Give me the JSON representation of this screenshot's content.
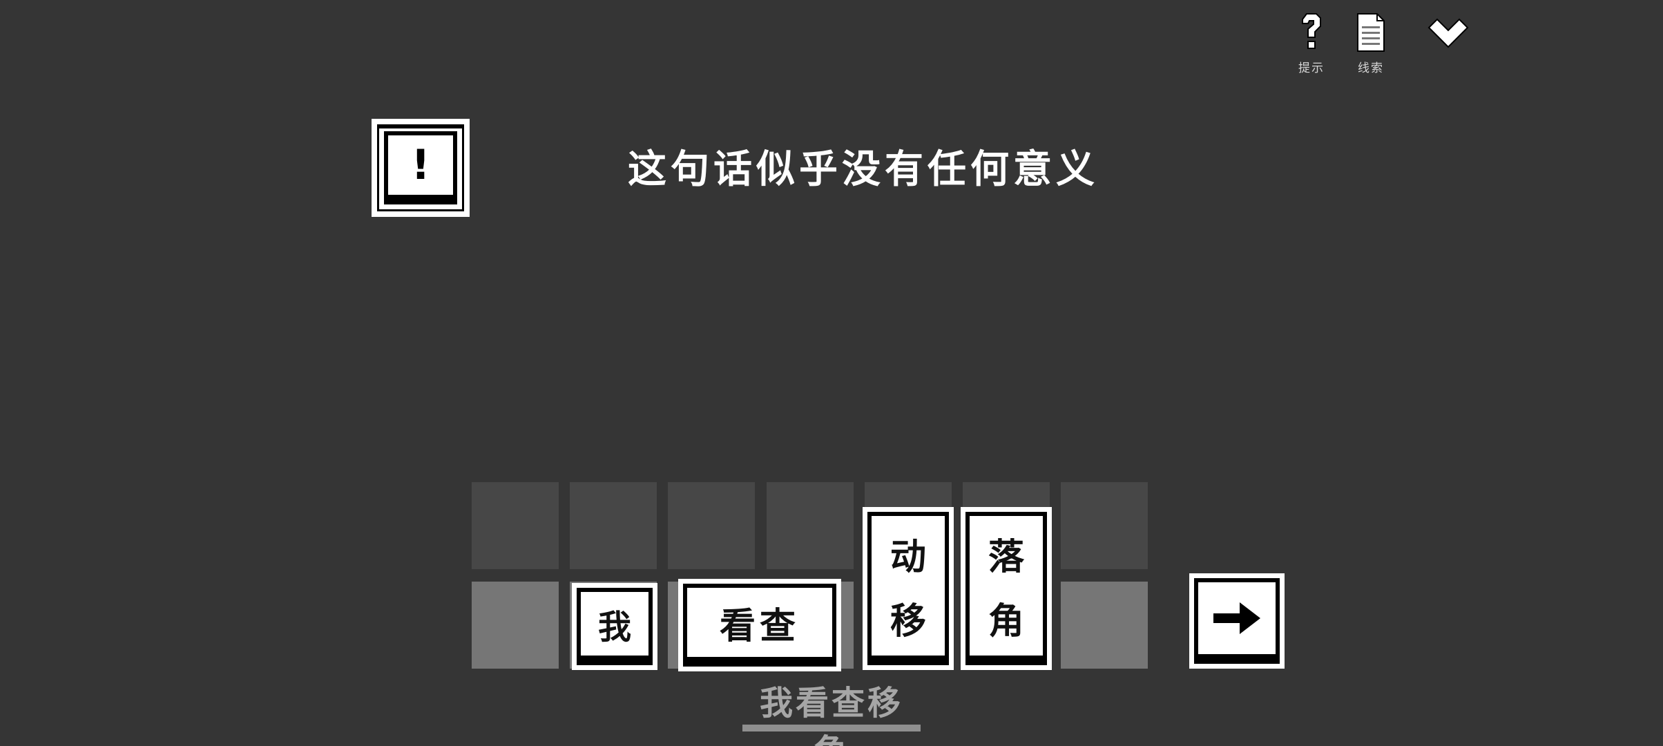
{
  "toolbar": {
    "hint_label": "提示",
    "clues_label": "线索"
  },
  "message": "这句话似乎没有任何意义",
  "alert_symbol": "!",
  "tiles": {
    "wo": "我",
    "kancha": "看查",
    "dong": "动",
    "yi": "移",
    "luo": "落",
    "jiao": "角"
  },
  "submit_icon": "arrow-right-icon",
  "answer_text": "我看查移角",
  "colors": {
    "background": "#353535",
    "slot_dark": "#474747",
    "slot_light": "#767676",
    "tile_face": "#ffffff",
    "tile_border": "#000000"
  }
}
